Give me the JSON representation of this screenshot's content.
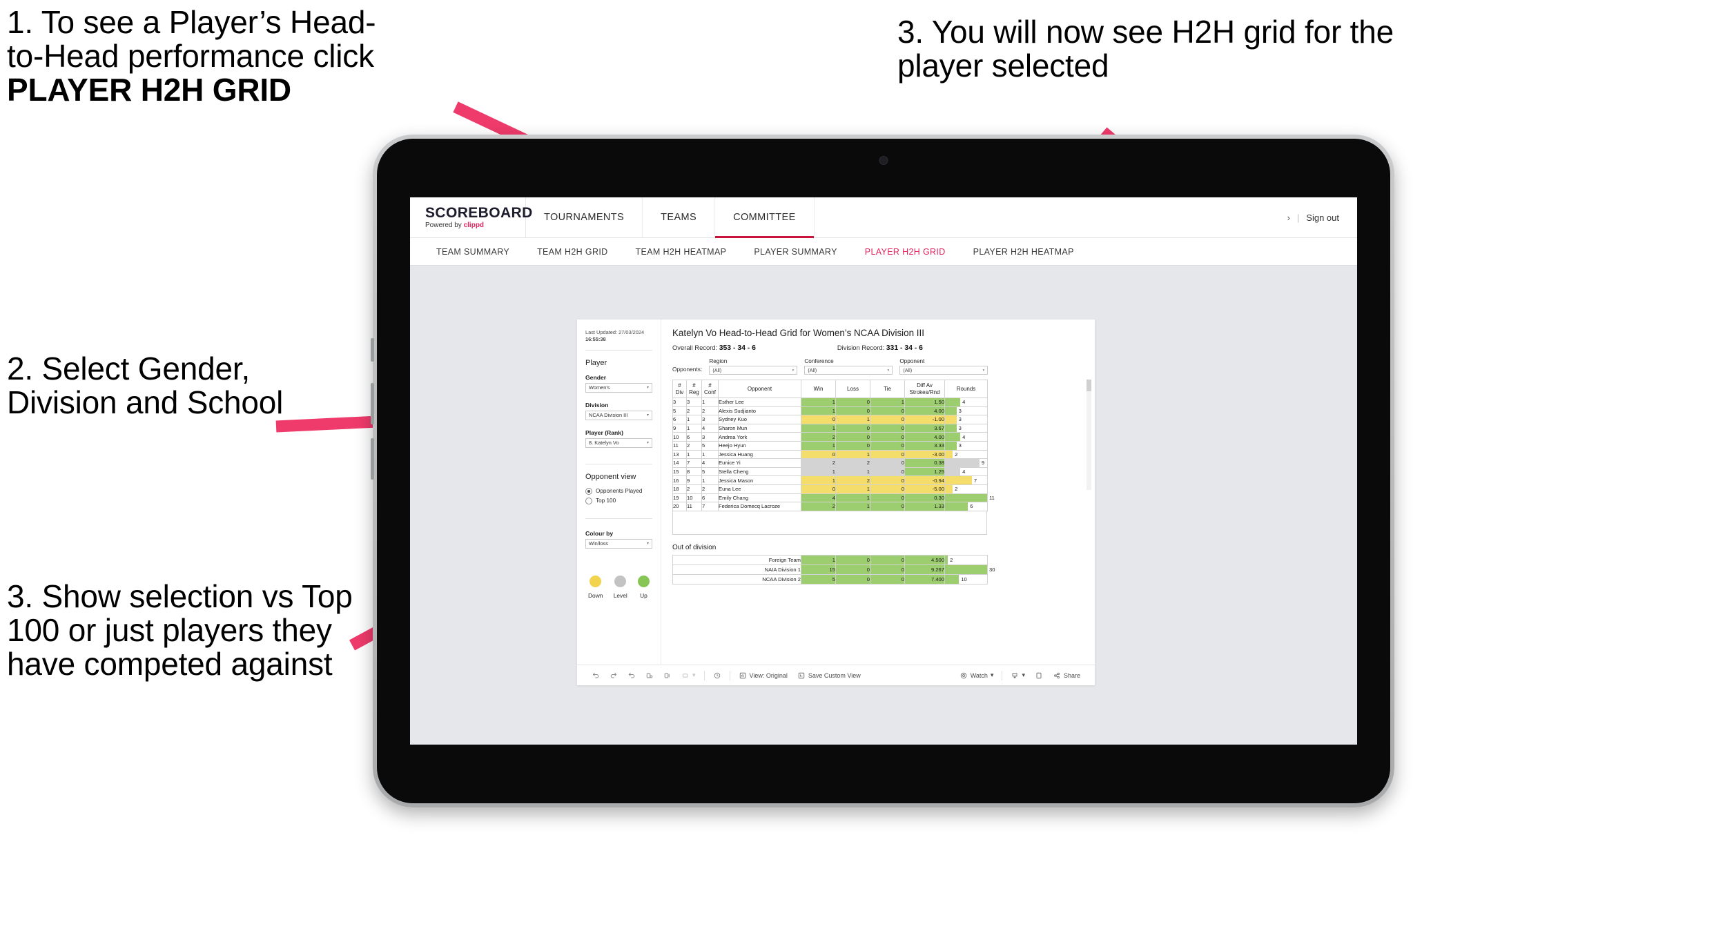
{
  "annotations": [
    {
      "id": "callout-1",
      "line1": "1. To see a Player’s Head-",
      "line2": "to-Head performance click",
      "line3": "PLAYER H2H GRID"
    },
    {
      "id": "callout-2",
      "text": "2. Select Gender, Division and School"
    },
    {
      "id": "callout-3",
      "text": "3. Show selection vs Top 100 or just players they have competed against"
    },
    {
      "id": "callout-4",
      "text": "3. You will now see H2H grid for the player selected"
    }
  ],
  "brand": {
    "name": "SCOREBOARD",
    "powered_prefix": "Powered by",
    "powered_name": "clippd",
    "accent": "#e0245e"
  },
  "topnav": {
    "items": [
      {
        "label": "TOURNAMENTS",
        "active": false
      },
      {
        "label": "TEAMS",
        "active": false
      },
      {
        "label": "COMMITTEE",
        "active": true
      }
    ],
    "chevron": "›",
    "divider": "|",
    "signout": "Sign out"
  },
  "subnav": {
    "items": [
      {
        "label": "TEAM SUMMARY",
        "active": false
      },
      {
        "label": "TEAM H2H GRID",
        "active": false
      },
      {
        "label": "TEAM H2H HEATMAP",
        "active": false
      },
      {
        "label": "PLAYER SUMMARY",
        "active": false
      },
      {
        "label": "PLAYER H2H GRID",
        "active": true
      },
      {
        "label": "PLAYER H2H HEATMAP",
        "active": false
      }
    ]
  },
  "panel": {
    "last_updated_label": "Last Updated: 27/03/2024",
    "last_updated_time": "16:55:38",
    "player_heading": "Player",
    "fields": [
      {
        "label": "Gender",
        "value": "Women's"
      },
      {
        "label": "Division",
        "value": "NCAA Division III"
      },
      {
        "label": "Player (Rank)",
        "value": "8. Katelyn Vo"
      }
    ],
    "opponent_view": {
      "heading": "Opponent view",
      "options": [
        {
          "label": "Opponents Played",
          "selected": true
        },
        {
          "label": "Top 100",
          "selected": false
        }
      ]
    },
    "colour_by": {
      "label": "Colour by",
      "value": "Win/loss"
    },
    "legend": [
      {
        "label": "Down",
        "color": "#f2d34e"
      },
      {
        "label": "Level",
        "color": "#c3c3c3"
      },
      {
        "label": "Up",
        "color": "#86c556"
      }
    ]
  },
  "view": {
    "title": "Katelyn Vo Head-to-Head Grid for Women’s NCAA Division III",
    "overall_record_label": "Overall Record:",
    "overall_record_value": "353 - 34 - 6",
    "division_record_label": "Division Record:",
    "division_record_value": "331 - 34 - 6",
    "opponents_label": "Opponents:",
    "filters": [
      {
        "caption": "Region",
        "value": "(All)"
      },
      {
        "caption": "Conference",
        "value": "(All)"
      },
      {
        "caption": "Opponent",
        "value": "(All)"
      }
    ]
  },
  "chart_data": {
    "type": "table",
    "title": "Katelyn Vo Head-to-Head Grid for Women’s NCAA Division III",
    "columns": [
      "# Div",
      "# Reg",
      "# Conf",
      "Opponent",
      "Win",
      "Loss",
      "Tie",
      "Diff Av Strokes/Rnd",
      "Rounds"
    ],
    "column_headers_multiline": [
      {
        "l1": "#",
        "l2": "Div"
      },
      {
        "l1": "#",
        "l2": "Reg"
      },
      {
        "l1": "#",
        "l2": "Conf"
      },
      {
        "l1": "Opponent",
        "l2": ""
      },
      {
        "l1": "Win",
        "l2": ""
      },
      {
        "l1": "Loss",
        "l2": ""
      },
      {
        "l1": "Tie",
        "l2": ""
      },
      {
        "l1": "Diff Av",
        "l2": "Strokes/Rnd"
      },
      {
        "l1": "Rounds",
        "l2": ""
      }
    ],
    "colors": {
      "up": "#9ccd6e",
      "down": "#f5dd6b",
      "level": "#d3d3d3",
      "white": "#ffffff"
    },
    "rounds_max": 11,
    "rows": [
      {
        "div": "3",
        "reg": "3",
        "conf": "1",
        "opponent": "Esther Lee",
        "win": "1",
        "loss": "0",
        "tie": "1",
        "diff": "1.50",
        "rounds": "4",
        "state": "up"
      },
      {
        "div": "5",
        "reg": "2",
        "conf": "2",
        "opponent": "Alexis Sudjianto",
        "win": "1",
        "loss": "0",
        "tie": "0",
        "diff": "4.00",
        "rounds": "3",
        "state": "up"
      },
      {
        "div": "6",
        "reg": "1",
        "conf": "3",
        "opponent": "Sydney Kuo",
        "win": "0",
        "loss": "1",
        "tie": "0",
        "diff": "-1.00",
        "rounds": "3",
        "state": "down"
      },
      {
        "div": "9",
        "reg": "1",
        "conf": "4",
        "opponent": "Sharon Mun",
        "win": "1",
        "loss": "0",
        "tie": "0",
        "diff": "3.67",
        "rounds": "3",
        "state": "up"
      },
      {
        "div": "10",
        "reg": "6",
        "conf": "3",
        "opponent": "Andrea York",
        "win": "2",
        "loss": "0",
        "tie": "0",
        "diff": "4.00",
        "rounds": "4",
        "state": "up"
      },
      {
        "div": "11",
        "reg": "2",
        "conf": "5",
        "opponent": "Heejo Hyun",
        "win": "1",
        "loss": "0",
        "tie": "0",
        "diff": "3.33",
        "rounds": "3",
        "state": "up"
      },
      {
        "div": "13",
        "reg": "1",
        "conf": "1",
        "opponent": "Jessica Huang",
        "win": "0",
        "loss": "1",
        "tie": "0",
        "diff": "-3.00",
        "rounds": "2",
        "state": "down"
      },
      {
        "div": "14",
        "reg": "7",
        "conf": "4",
        "opponent": "Eunice Yi",
        "win": "2",
        "loss": "2",
        "tie": "0",
        "diff": "0.38",
        "rounds": "9",
        "state": "level",
        "diff_state": "up"
      },
      {
        "div": "15",
        "reg": "8",
        "conf": "5",
        "opponent": "Stella Cheng",
        "win": "1",
        "loss": "1",
        "tie": "0",
        "diff": "1.25",
        "rounds": "4",
        "state": "level",
        "diff_state": "up"
      },
      {
        "div": "16",
        "reg": "9",
        "conf": "1",
        "opponent": "Jessica Mason",
        "win": "1",
        "loss": "2",
        "tie": "0",
        "diff": "-0.94",
        "rounds": "7",
        "state": "down"
      },
      {
        "div": "18",
        "reg": "2",
        "conf": "2",
        "opponent": "Euna Lee",
        "win": "0",
        "loss": "1",
        "tie": "0",
        "diff": "-5.00",
        "rounds": "2",
        "state": "down"
      },
      {
        "div": "19",
        "reg": "10",
        "conf": "6",
        "opponent": "Emily Chang",
        "win": "4",
        "loss": "1",
        "tie": "0",
        "diff": "0.30",
        "rounds": "11",
        "state": "up"
      },
      {
        "div": "20",
        "reg": "11",
        "conf": "7",
        "opponent": "Federica Domecq Lacroze",
        "win": "2",
        "loss": "1",
        "tie": "0",
        "diff": "1.33",
        "rounds": "6",
        "state": "up"
      }
    ],
    "out_of_division": {
      "title": "Out of division",
      "rounds_max": 30,
      "rows": [
        {
          "name": "Foreign Team",
          "win": "1",
          "loss": "0",
          "tie": "0",
          "diff": "4.500",
          "rounds": "2",
          "state": "up"
        },
        {
          "name": "NAIA Division 1",
          "win": "15",
          "loss": "0",
          "tie": "0",
          "diff": "9.267",
          "rounds": "30",
          "state": "up"
        },
        {
          "name": "NCAA Division 2",
          "win": "5",
          "loss": "0",
          "tie": "0",
          "diff": "7.400",
          "rounds": "10",
          "state": "up"
        }
      ]
    }
  },
  "toolbar": {
    "view_original": "View: Original",
    "save_custom_view": "Save Custom View",
    "watch": "Watch",
    "share": "Share",
    "caret": "▾"
  }
}
